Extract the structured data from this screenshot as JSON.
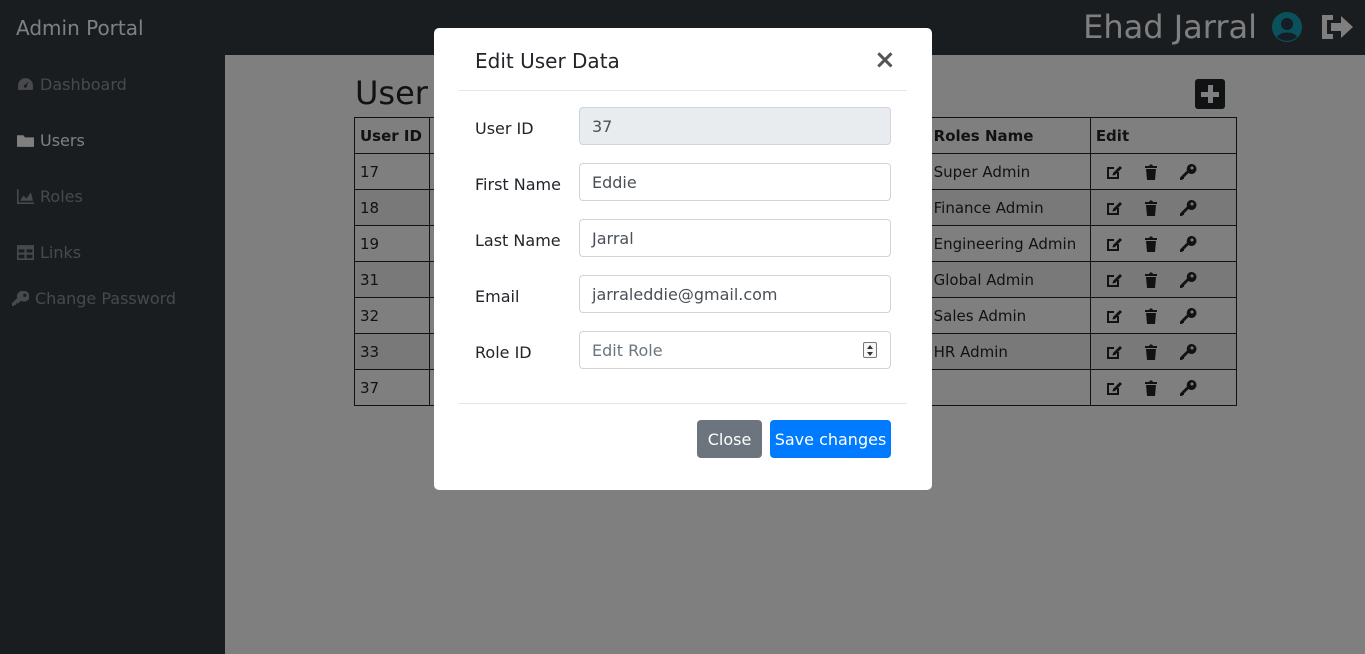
{
  "navbar": {
    "brand": "Admin Portal",
    "username": "Ehad Jarral",
    "user_icon": "user-circle-icon",
    "logout_icon": "sign-out-icon"
  },
  "sidebar": {
    "items": [
      {
        "label": "Dashboard",
        "icon": "tachometer-icon"
      },
      {
        "label": "Users",
        "icon": "folder-icon"
      },
      {
        "label": "Roles",
        "icon": "area-chart-icon"
      },
      {
        "label": "Links",
        "icon": "table-icon"
      },
      {
        "label": "Change Password",
        "icon": "key-icon"
      }
    ]
  },
  "main": {
    "title": "User D",
    "table": {
      "headers": [
        "User ID",
        "",
        "Roles Name",
        "Edit"
      ],
      "rows": [
        {
          "id": "17",
          "role": "Super Admin"
        },
        {
          "id": "18",
          "role": "Finance Admin"
        },
        {
          "id": "19",
          "role": "Engineering Admin"
        },
        {
          "id": "31",
          "role": "Global Admin"
        },
        {
          "id": "32",
          "role": "Sales Admin"
        },
        {
          "id": "33",
          "role": "HR Admin"
        },
        {
          "id": "37",
          "role": ""
        }
      ]
    }
  },
  "modal": {
    "title": "Edit User Data",
    "close_symbol": "×",
    "fields": {
      "user_id": {
        "label": "User ID",
        "value": "37"
      },
      "first_name": {
        "label": "First Name",
        "value": "Eddie"
      },
      "last_name": {
        "label": "Last Name",
        "value": "Jarral"
      },
      "email": {
        "label": "Email",
        "value": "jarraleddie@gmail.com"
      },
      "role_id": {
        "label": "Role ID",
        "placeholder": "Edit Role"
      }
    },
    "buttons": {
      "close": "Close",
      "save": "Save changes"
    }
  },
  "colors": {
    "navbar": "#343a40",
    "primary": "#007bff",
    "secondary": "#6c757d"
  }
}
